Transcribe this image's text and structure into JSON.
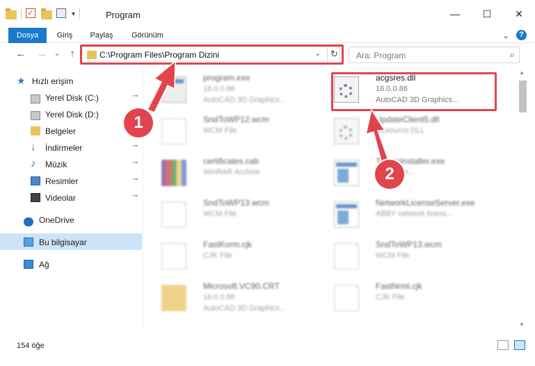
{
  "window": {
    "title": "Program",
    "minimize_glyph": "—",
    "maximize_glyph": "☐",
    "close_glyph": "✕"
  },
  "ribbon": {
    "tabs": [
      "Dosya",
      "Giriş",
      "Paylaş",
      "Görünüm"
    ],
    "expand_glyph": "⌄",
    "help_glyph": "?"
  },
  "nav": {
    "back_glyph": "←",
    "forward_glyph": "→",
    "recent_glyph": "⌄",
    "up_glyph": "↑"
  },
  "address": {
    "path": "C:\\Program Files\\Program Dizini",
    "dropdown_glyph": "⌄",
    "refresh_glyph": "↻"
  },
  "search": {
    "placeholder": "Ara: Program",
    "icon_glyph": "⌕"
  },
  "sidebar": {
    "items": [
      {
        "label": "Hızlı erişim",
        "icon": "star-icon",
        "pinned": false
      },
      {
        "label": "Yerel Disk (C:)",
        "icon": "disk-icon",
        "pinned": true
      },
      {
        "label": "Yerel Disk (D:)",
        "icon": "disk-icon",
        "pinned": false
      },
      {
        "label": "Belgeler",
        "icon": "documents-icon",
        "pinned": false
      },
      {
        "label": "İndirmeler",
        "icon": "download-icon",
        "pinned": true
      },
      {
        "label": "Müzik",
        "icon": "music-icon",
        "pinned": true
      },
      {
        "label": "Resimler",
        "icon": "pictures-icon",
        "pinned": true
      },
      {
        "label": "Videolar",
        "icon": "videos-icon",
        "pinned": true
      },
      {
        "label": "OneDrive",
        "icon": "onedrive-icon",
        "pinned": false
      },
      {
        "label": "Bu bilgisayar",
        "icon": "this-pc-icon",
        "pinned": false,
        "selected": true
      },
      {
        "label": "Ağ",
        "icon": "network-icon",
        "pinned": false
      }
    ],
    "pin_glyph": "📌"
  },
  "files": [
    {
      "name": "program.exe",
      "line2": "16.0.0.86",
      "line3": "AutoCAD 3D Graphics...",
      "type": "exe"
    },
    {
      "name": "acgsres.dll",
      "line2": "16.0.0.86",
      "line3": "AutoCAD 3D Graphics...",
      "type": "dll"
    },
    {
      "name": "SndToWP12.wcm",
      "line2": "WCM File",
      "line3": "",
      "type": "doc"
    },
    {
      "name": "UpdateClient5.dll",
      "line2": "Resource DLL",
      "line3": "",
      "type": "dll"
    },
    {
      "name": "certificates.cab",
      "line2": "WinRAR Archive",
      "line3": "",
      "type": "rar"
    },
    {
      "name": "TeamsInstaller.exe",
      "line2": "...eader tr...",
      "line3": "",
      "type": "win"
    },
    {
      "name": "SndToWP13.wcm",
      "line2": "WCM File",
      "line3": "",
      "type": "doc"
    },
    {
      "name": "NetworkLicenseServer.exe",
      "line2": "ABBY network licens...",
      "line3": "",
      "type": "win"
    },
    {
      "name": "FastKorm.cjk",
      "line2": "CJK File",
      "line3": "",
      "type": "doc"
    },
    {
      "name": "SndToWP13.wcm",
      "line2": "WCM File",
      "line3": "",
      "type": "doc"
    },
    {
      "name": "Microsoft.VC90.CRT",
      "line2": "16.0.0.86",
      "line3": "AutoCAD 3D Graphics...",
      "type": "folder"
    },
    {
      "name": "FastNrml.cjk",
      "line2": "CJK File",
      "line3": "",
      "type": "doc"
    }
  ],
  "status": {
    "item_count": "154 öğe"
  },
  "annotations": {
    "step1": "1",
    "step2": "2",
    "color": "#e0454b"
  }
}
